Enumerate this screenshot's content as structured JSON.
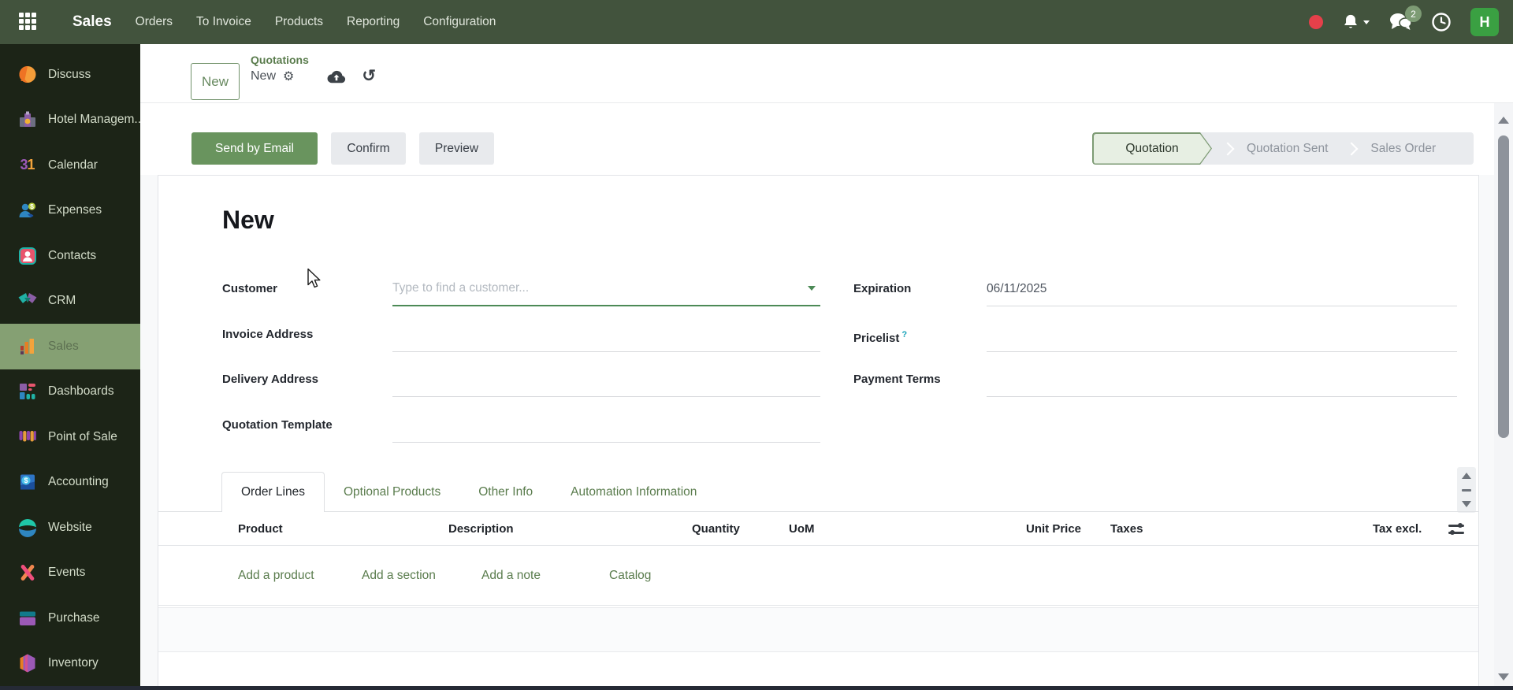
{
  "navbar": {
    "brand": "Sales",
    "menu": [
      "Orders",
      "To Invoice",
      "Products",
      "Reporting",
      "Configuration"
    ],
    "messages_badge": "2",
    "avatar_initial": "H",
    "icons": [
      "apps-grid-icon",
      "recording-indicator",
      "bell-icon",
      "chat-icon",
      "clock-icon"
    ]
  },
  "sidebar": {
    "active_item": "Sales",
    "items": [
      {
        "label": "Discuss",
        "icon": "discuss-icon"
      },
      {
        "label": "Hotel Managem...",
        "icon": "hotel-icon"
      },
      {
        "label": "Calendar",
        "icon": "calendar-icon",
        "icon_text_a": "3",
        "icon_text_b": "1"
      },
      {
        "label": "Expenses",
        "icon": "expenses-icon"
      },
      {
        "label": "Contacts",
        "icon": "contacts-icon"
      },
      {
        "label": "CRM",
        "icon": "crm-icon"
      },
      {
        "label": "Sales",
        "icon": "sales-icon"
      },
      {
        "label": "Dashboards",
        "icon": "dashboards-icon"
      },
      {
        "label": "Point of Sale",
        "icon": "pos-icon"
      },
      {
        "label": "Accounting",
        "icon": "accounting-icon"
      },
      {
        "label": "Website",
        "icon": "website-icon"
      },
      {
        "label": "Events",
        "icon": "events-icon"
      },
      {
        "label": "Purchase",
        "icon": "purchase-icon"
      },
      {
        "label": "Inventory",
        "icon": "inventory-icon"
      }
    ]
  },
  "breadcrumb": {
    "new_button": "New",
    "parent": "Quotations",
    "current": "New",
    "gear_icon": "⚙",
    "undo_icon": "↺",
    "icons": [
      "gear-icon",
      "cloud-upload-icon",
      "undo-icon"
    ]
  },
  "actions": {
    "send_by_email": "Send by Email",
    "confirm": "Confirm",
    "preview": "Preview"
  },
  "statusbar": {
    "steps": [
      "Quotation",
      "Quotation Sent",
      "Sales Order"
    ],
    "active_step": "Quotation"
  },
  "form": {
    "title": "New",
    "fields": {
      "customer": {
        "label": "Customer",
        "placeholder": "Type to find a customer...",
        "value": ""
      },
      "invoice_address": {
        "label": "Invoice Address",
        "value": ""
      },
      "delivery_address": {
        "label": "Delivery Address",
        "value": ""
      },
      "quotation_template": {
        "label": "Quotation Template",
        "value": ""
      },
      "expiration": {
        "label": "Expiration",
        "value": "06/11/2025"
      },
      "pricelist": {
        "label": "Pricelist",
        "help_marker": "?",
        "value": ""
      },
      "payment_terms": {
        "label": "Payment Terms",
        "value": ""
      }
    }
  },
  "tabs": {
    "active": "Order Lines",
    "items": [
      "Order Lines",
      "Optional Products",
      "Other Info",
      "Automation Information"
    ]
  },
  "order_lines": {
    "columns": {
      "product": "Product",
      "description": "Description",
      "quantity": "Quantity",
      "uom": "UoM",
      "unit_price": "Unit Price",
      "taxes": "Taxes",
      "tax_excl": "Tax excl."
    },
    "links": {
      "add_product": "Add a product",
      "add_section": "Add a section",
      "add_note": "Add a note",
      "catalog": "Catalog"
    }
  },
  "colors": {
    "navbar_bg": "#42533d",
    "sidebar_bg": "#1c2417",
    "sidebar_active_bg": "#85a073",
    "accent_green": "#5a7c4d",
    "primary_button_bg": "#69945e",
    "avatar_bg": "#3aa042",
    "recording_red": "#e5404a",
    "focus_underline_green": "#4c8a56",
    "help_cyan": "#17a2b8"
  }
}
